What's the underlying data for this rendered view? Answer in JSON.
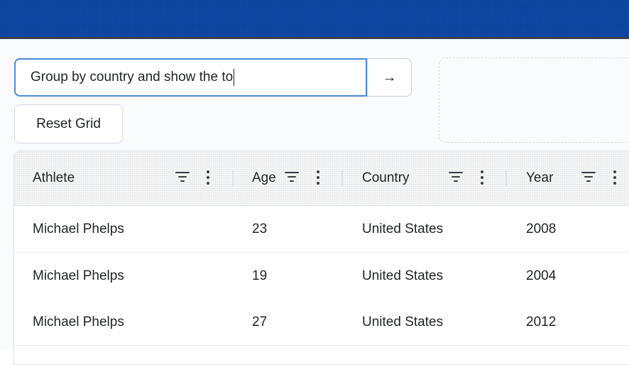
{
  "query": {
    "value": "Group by country and show the to",
    "submit_icon": "arrow-right-icon",
    "submit_glyph": "→"
  },
  "reset_button_label": "Reset Grid",
  "grid": {
    "columns": [
      {
        "label": "Athlete"
      },
      {
        "label": "Age"
      },
      {
        "label": "Country"
      },
      {
        "label": "Year"
      }
    ],
    "rows": [
      {
        "athlete": "Michael Phelps",
        "age": "23",
        "country": "United States",
        "year": "2008"
      },
      {
        "athlete": "Michael Phelps",
        "age": "19",
        "country": "United States",
        "year": "2004"
      },
      {
        "athlete": "Michael Phelps",
        "age": "27",
        "country": "United States",
        "year": "2012"
      }
    ]
  },
  "colors": {
    "topbar": "#0f4aa8",
    "input_focus_border": "#4a8ad8"
  }
}
